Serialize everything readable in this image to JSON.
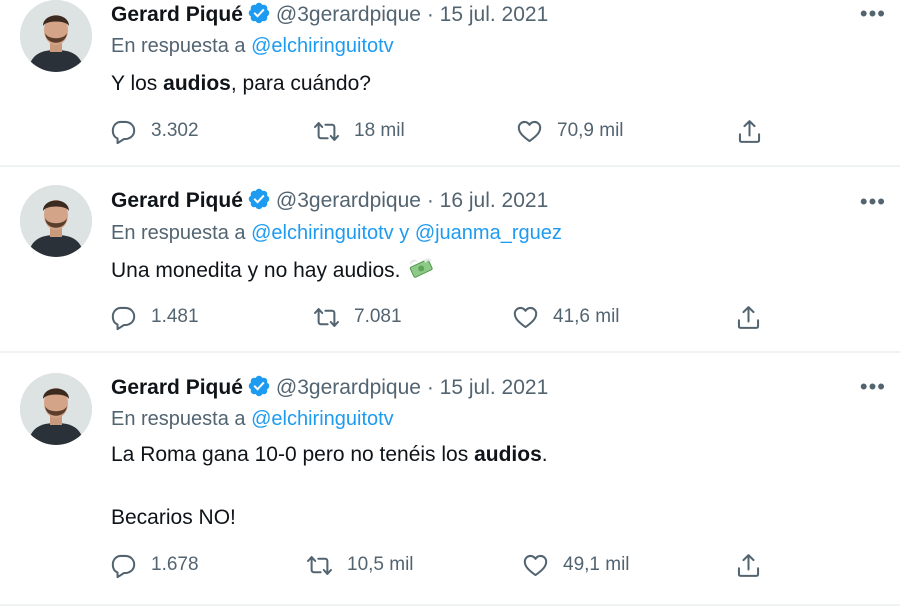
{
  "tweets": [
    {
      "name": "Gerard Piqué",
      "handle": "@3gerardpique",
      "date": "15 jul. 2021",
      "reply_prefix": "En respuesta a",
      "reply_mention_1": "@elchiringuitotv",
      "text_a": "Y los ",
      "text_bold": "audios",
      "text_b": ", para cuándo?",
      "replies": "3.302",
      "retweets": "18 mil",
      "likes": "70,9 mil"
    },
    {
      "name": "Gerard Piqué",
      "handle": "@3gerardpique",
      "date": "16 jul. 2021",
      "reply_prefix": "En respuesta a",
      "reply_mention_1": "@elchiringuitotv",
      "reply_and": "y",
      "reply_mention_2": "@juanma_rguez",
      "text": "Una monedita y no hay audios.",
      "emoji": "money-with-wings-emoji",
      "replies": "1.481",
      "retweets": "7.081",
      "likes": "41,6 mil"
    },
    {
      "name": "Gerard Piqué",
      "handle": "@3gerardpique",
      "date": "15 jul. 2021",
      "reply_prefix": "En respuesta a",
      "reply_mention_1": "@elchiringuitotv",
      "text_a": "La Roma gana 10-0 pero no tenéis los ",
      "text_bold": "audios",
      "text_b": ".",
      "text_line2": "Becarios NO!",
      "replies": "1.678",
      "retweets": "10,5 mil",
      "likes": "49,1 mil"
    }
  ],
  "separator": "·",
  "more": "•••",
  "colors": {
    "verified": "#1d9bf0",
    "link": "#1d9bf0",
    "muted": "#536471"
  }
}
